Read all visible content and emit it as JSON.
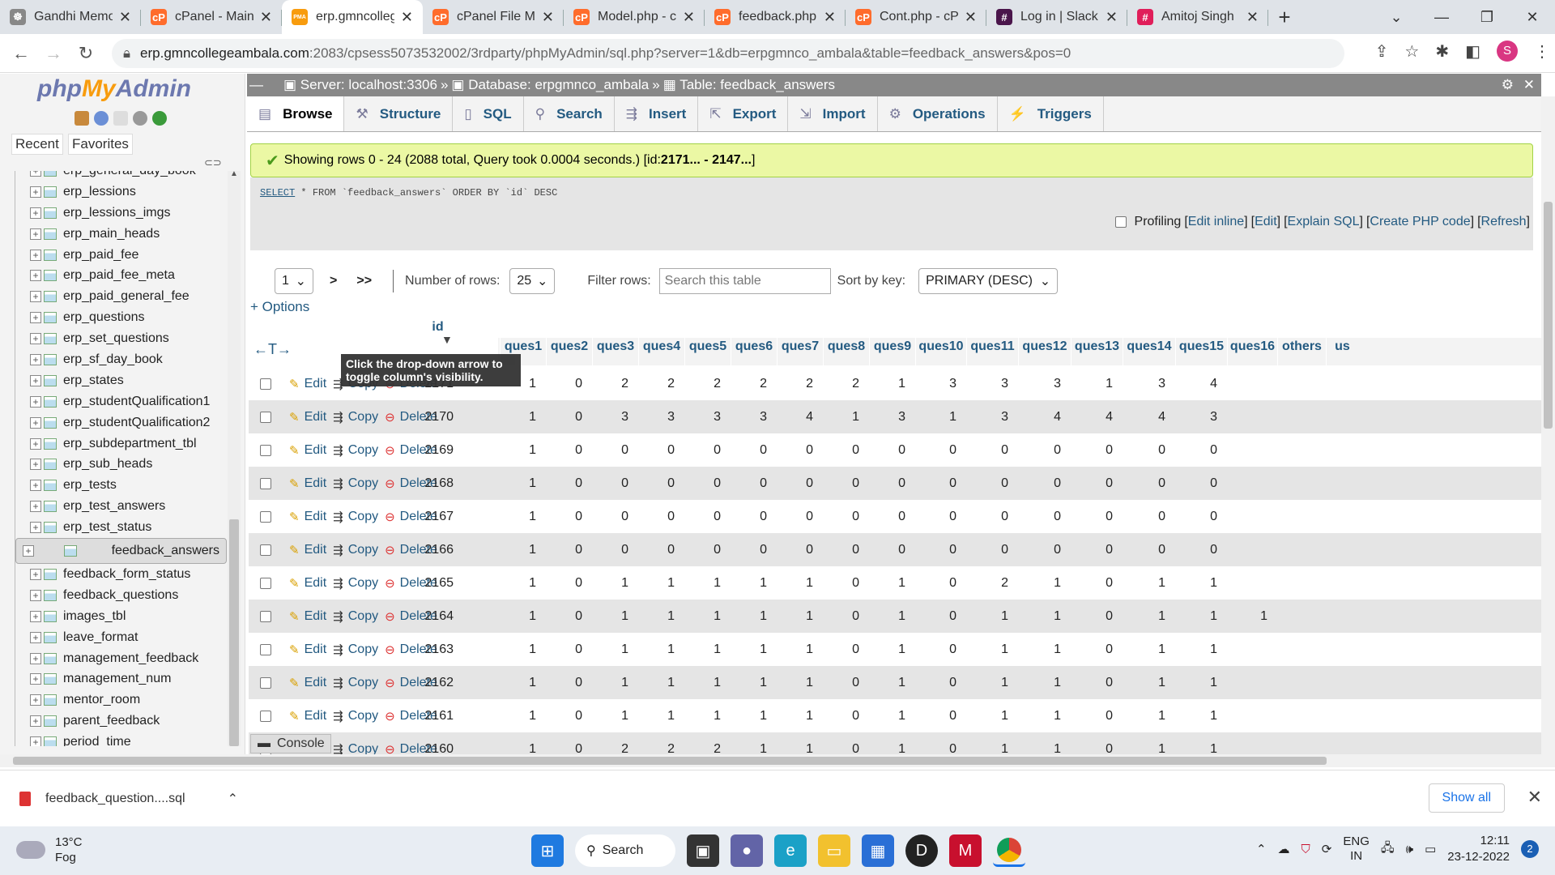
{
  "browser": {
    "tabs": [
      {
        "title": "Gandhi Memo",
        "color": "#888888",
        "glyph": "☸"
      },
      {
        "title": "cPanel - Main",
        "color": "#ff6c2c",
        "glyph": "cP"
      },
      {
        "title": "erp.gmncolleg",
        "color": "#f89c0e",
        "glyph": "PMA",
        "active": true
      },
      {
        "title": "cPanel File Ma",
        "color": "#ff6c2c",
        "glyph": "cP"
      },
      {
        "title": "Model.php - c",
        "color": "#ff6c2c",
        "glyph": "cP"
      },
      {
        "title": "feedback.php",
        "color": "#ff6c2c",
        "glyph": "cP"
      },
      {
        "title": "Cont.php - cP",
        "color": "#ff6c2c",
        "glyph": "cP"
      },
      {
        "title": "Log in | Slack",
        "color": "#4a154b",
        "glyph": "#"
      },
      {
        "title": "Amitoj Singh",
        "color": "#e01e5a",
        "glyph": "#"
      }
    ],
    "url_host": "erp.gmncollegeambala.com",
    "url_rest": ":2083/cpsess5073532002/3rdparty/phpMyAdmin/sql.php?server=1&db=erpgmnco_ambala&table=feedback_answers&pos=0",
    "profile_initial": "S"
  },
  "pma": {
    "logo": {
      "php": "php",
      "my": "My",
      "admin": "Admin"
    },
    "recent": "Recent",
    "favorites": "Favorites",
    "tree": [
      "erp_general_day_book",
      "erp_lessions",
      "erp_lessions_imgs",
      "erp_main_heads",
      "erp_paid_fee",
      "erp_paid_fee_meta",
      "erp_paid_general_fee",
      "erp_questions",
      "erp_set_questions",
      "erp_sf_day_book",
      "erp_states",
      "erp_studentQualification1",
      "erp_studentQualification2",
      "erp_subdepartment_tbl",
      "erp_sub_heads",
      "erp_tests",
      "erp_test_answers",
      "erp_test_status",
      "feedback_answers",
      "feedback_form_status",
      "feedback_questions",
      "images_tbl",
      "leave_format",
      "management_feedback",
      "management_num",
      "mentor_room",
      "parent_feedback",
      "period_time"
    ],
    "selected_table": "feedback_answers",
    "breadcrumb": {
      "server": "Server: localhost:3306",
      "database": "Database: erpgmnco_ambala",
      "table": "Table: feedback_answers"
    },
    "tabs": [
      {
        "label": "Browse",
        "icon": "▤"
      },
      {
        "label": "Structure",
        "icon": "⚒"
      },
      {
        "label": "SQL",
        "icon": "▯"
      },
      {
        "label": "Search",
        "icon": "⚲"
      },
      {
        "label": "Insert",
        "icon": "⇶"
      },
      {
        "label": "Export",
        "icon": "⇱"
      },
      {
        "label": "Import",
        "icon": "⇲"
      },
      {
        "label": "Operations",
        "icon": "⚙"
      },
      {
        "label": "Triggers",
        "icon": "⚡"
      }
    ],
    "success_msg_pre": "Showing rows 0 - 24 (2088 total, Query took 0.0004 seconds.) [id: ",
    "success_msg_ids": "2171... - 2147...",
    "success_msg_post": "]",
    "sql_select": "SELECT",
    "sql_rest": " * FROM `feedback_answers` ORDER BY `id` DESC",
    "profiling": "Profiling",
    "sql_links": [
      "Edit inline",
      "Edit",
      "Explain SQL",
      "Create PHP code",
      "Refresh"
    ],
    "page_select": "1",
    "next": ">",
    "last": ">>",
    "num_rows_label": "Number of rows:",
    "num_rows": "25",
    "filter_label": "Filter rows:",
    "filter_placeholder": "Search this table",
    "sort_label": "Sort by key:",
    "sort_value": "PRIMARY (DESC)",
    "options": "+ Options",
    "tooltip": "Click the drop-down arrow to toggle column's visibility.",
    "console": "Console",
    "action_labels": {
      "edit": "Edit",
      "copy": "Copy",
      "delete": "Delete"
    },
    "columns": [
      "id",
      "ques1",
      "ques2",
      "ques3",
      "ques4",
      "ques5",
      "ques6",
      "ques7",
      "ques8",
      "ques9",
      "ques10",
      "ques11",
      "ques12",
      "ques13",
      "ques14",
      "ques15",
      "ques16",
      "others",
      "us"
    ],
    "rows": [
      {
        "id": "2171",
        "v": [
          "1",
          "0",
          "2",
          "2",
          "2",
          "2",
          "2",
          "2",
          "1",
          "3",
          "3",
          "3",
          "1",
          "3",
          "4",
          "",
          ""
        ]
      },
      {
        "id": "2170",
        "v": [
          "1",
          "0",
          "3",
          "3",
          "3",
          "3",
          "4",
          "1",
          "3",
          "1",
          "3",
          "4",
          "4",
          "4",
          "3",
          "",
          ""
        ]
      },
      {
        "id": "2169",
        "v": [
          "1",
          "0",
          "0",
          "0",
          "0",
          "0",
          "0",
          "0",
          "0",
          "0",
          "0",
          "0",
          "0",
          "0",
          "0",
          "",
          ""
        ]
      },
      {
        "id": "2168",
        "v": [
          "1",
          "0",
          "0",
          "0",
          "0",
          "0",
          "0",
          "0",
          "0",
          "0",
          "0",
          "0",
          "0",
          "0",
          "0",
          "",
          ""
        ]
      },
      {
        "id": "2167",
        "v": [
          "1",
          "0",
          "0",
          "0",
          "0",
          "0",
          "0",
          "0",
          "0",
          "0",
          "0",
          "0",
          "0",
          "0",
          "0",
          "",
          ""
        ]
      },
      {
        "id": "2166",
        "v": [
          "1",
          "0",
          "0",
          "0",
          "0",
          "0",
          "0",
          "0",
          "0",
          "0",
          "0",
          "0",
          "0",
          "0",
          "0",
          "",
          ""
        ]
      },
      {
        "id": "2165",
        "v": [
          "1",
          "0",
          "1",
          "1",
          "1",
          "1",
          "1",
          "0",
          "1",
          "0",
          "2",
          "1",
          "0",
          "1",
          "1",
          "",
          ""
        ]
      },
      {
        "id": "2164",
        "v": [
          "1",
          "0",
          "1",
          "1",
          "1",
          "1",
          "1",
          "0",
          "1",
          "0",
          "1",
          "1",
          "0",
          "1",
          "1",
          "1",
          ""
        ]
      },
      {
        "id": "2163",
        "v": [
          "1",
          "0",
          "1",
          "1",
          "1",
          "1",
          "1",
          "0",
          "1",
          "0",
          "1",
          "1",
          "0",
          "1",
          "1",
          "",
          ""
        ]
      },
      {
        "id": "2162",
        "v": [
          "1",
          "0",
          "1",
          "1",
          "1",
          "1",
          "1",
          "0",
          "1",
          "0",
          "1",
          "1",
          "0",
          "1",
          "1",
          "",
          ""
        ]
      },
      {
        "id": "2161",
        "v": [
          "1",
          "0",
          "1",
          "1",
          "1",
          "1",
          "1",
          "0",
          "1",
          "0",
          "1",
          "1",
          "0",
          "1",
          "1",
          "",
          ""
        ]
      },
      {
        "id": "2160",
        "v": [
          "1",
          "0",
          "2",
          "2",
          "2",
          "1",
          "1",
          "0",
          "1",
          "0",
          "1",
          "1",
          "0",
          "1",
          "1",
          "",
          ""
        ]
      }
    ]
  },
  "download": {
    "filename": "feedback_question....sql",
    "show_all": "Show all"
  },
  "taskbar": {
    "temp": "13°C",
    "weather": "Fog",
    "search": "Search",
    "lang1": "ENG",
    "lang2": "IN",
    "time": "12:11",
    "date": "23-12-2022",
    "notif": "2"
  }
}
